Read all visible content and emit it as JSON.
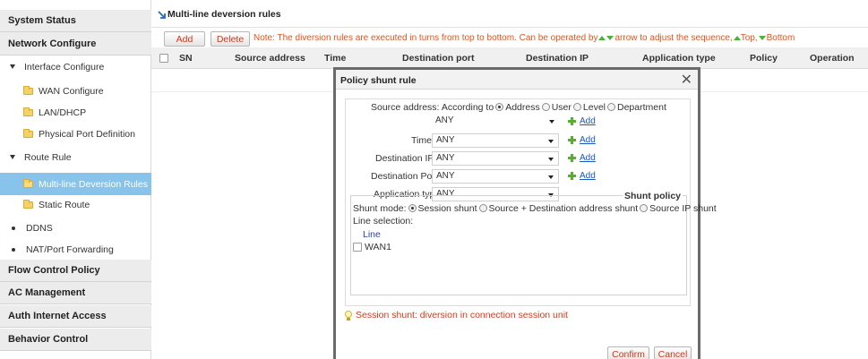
{
  "sidebar": {
    "system_status": "System Status",
    "network_configure": "Network Configure",
    "interface_configure": "Interface Configure",
    "wan_configure": "WAN Configure",
    "lan_dhcp": "LAN/DHCP",
    "physical_port": "Physical Port Definition",
    "route_rule": "Route Rule",
    "multiline_rules": "Multi-line Deversion Rules",
    "static_route": "Static Route",
    "ddns": "DDNS",
    "nat_port_forwarding": "NAT/Port Forwarding",
    "flow_control": "Flow Control Policy",
    "ac_management": "AC Management",
    "auth_internet": "Auth Internet Access",
    "behavior_control": "Behavior Control"
  },
  "content": {
    "title": "Multi-line deversion rules",
    "add_label": "Add",
    "delete_label": "Delete",
    "note_part1": "Note: The diversion rules are executed in turns from top to bottom. Can be operated by",
    "note_part2": "arrow to adjust the sequence,",
    "note_top": "Top,",
    "note_bottom": "Bottom"
  },
  "table": {
    "columns": [
      "SN",
      "Source address",
      "Time",
      "Destination port",
      "Destination IP",
      "Application type",
      "Policy",
      "Operation"
    ]
  },
  "modal": {
    "title": "Policy shunt rule",
    "close": "✕",
    "source_address_label": "Source address:",
    "according_to": "According to",
    "radio_address": "Address",
    "radio_user": "User",
    "radio_level": "Level",
    "radio_department": "Department",
    "source_select": "ANY",
    "add_link": "Add",
    "time_label": "Time:",
    "time_select": "ANY",
    "dest_ip_label": "Destination IP:",
    "dest_ip_select": "ANY",
    "dest_port_label": "Destination Port:",
    "dest_port_select": "ANY",
    "app_type_label": "Application type:",
    "app_type_select": "ANY",
    "shunt_policy_legend": "Shunt policy",
    "shunt_mode_label": "Shunt mode:",
    "mode_session": "Session shunt",
    "mode_src_dst": "Source + Destination address shunt",
    "mode_src_ip": "Source IP shunt",
    "line_selection_label": "Line selection:",
    "line_header": "Line",
    "wan1": "WAN1",
    "hint": "Session shunt: diversion in connection session unit",
    "confirm": "Confirm",
    "cancel": "Cancel"
  }
}
